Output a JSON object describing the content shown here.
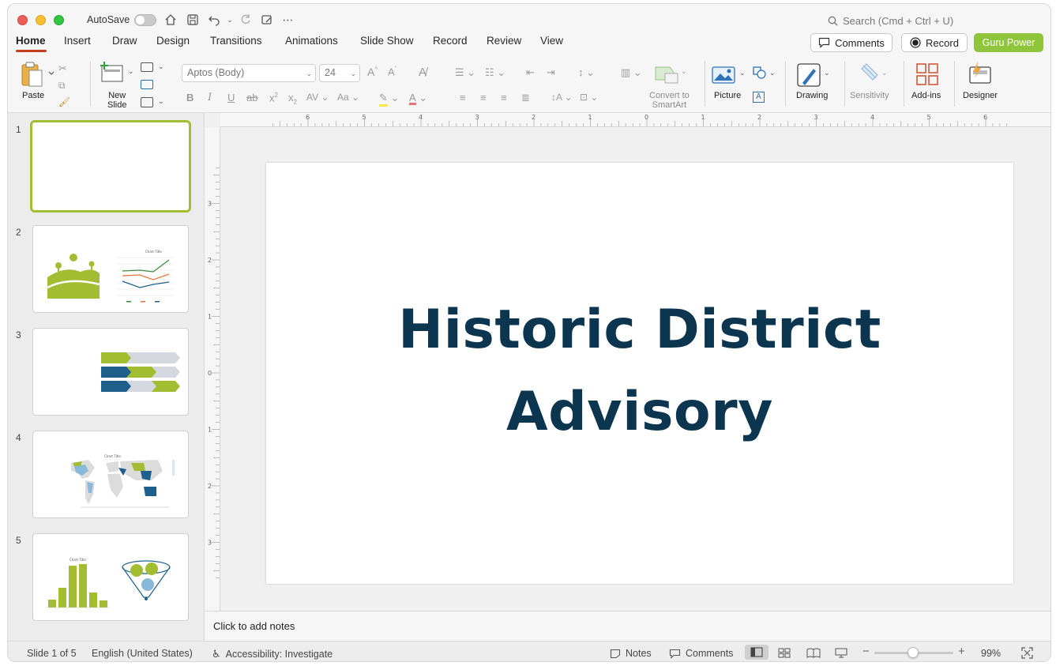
{
  "titlebar": {
    "autosave_label": "AutoSave",
    "search_placeholder": "Search (Cmd + Ctrl + U)"
  },
  "tabs": [
    {
      "label": "Home"
    },
    {
      "label": "Insert"
    },
    {
      "label": "Draw"
    },
    {
      "label": "Design"
    },
    {
      "label": "Transitions"
    },
    {
      "label": "Animations"
    },
    {
      "label": "Slide Show"
    },
    {
      "label": "Record"
    },
    {
      "label": "Review"
    },
    {
      "label": "View"
    }
  ],
  "header_buttons": {
    "comments": "Comments",
    "record": "Record",
    "guru": "Guru Power"
  },
  "ribbon": {
    "paste": "Paste",
    "new_slide_line1": "New",
    "new_slide_line2": "Slide",
    "font_name": "Aptos (Body)",
    "font_size": "24",
    "convert_line1": "Convert to",
    "convert_line2": "SmartArt",
    "picture": "Picture",
    "drawing": "Drawing",
    "sensitivity": "Sensitivity",
    "addins": "Add-ins",
    "designer": "Designer"
  },
  "slides": [
    {
      "number": "1"
    },
    {
      "number": "2"
    },
    {
      "number": "3"
    },
    {
      "number": "4"
    },
    {
      "number": "5"
    }
  ],
  "slide": {
    "title_line1": "Historic District",
    "title_line2": "Advisory"
  },
  "notes": {
    "placeholder": "Click to add notes"
  },
  "status": {
    "slide_counter": "Slide 1 of 5",
    "language": "English (United States)",
    "accessibility": "Accessibility: Investigate",
    "notes": "Notes",
    "comments": "Comments",
    "zoom": "99%"
  },
  "colors": {
    "accent_green": "#a3bd32",
    "dark_blue": "#0c3550",
    "tab_underline": "#c43e1c",
    "guru_button": "#8fc53a"
  }
}
